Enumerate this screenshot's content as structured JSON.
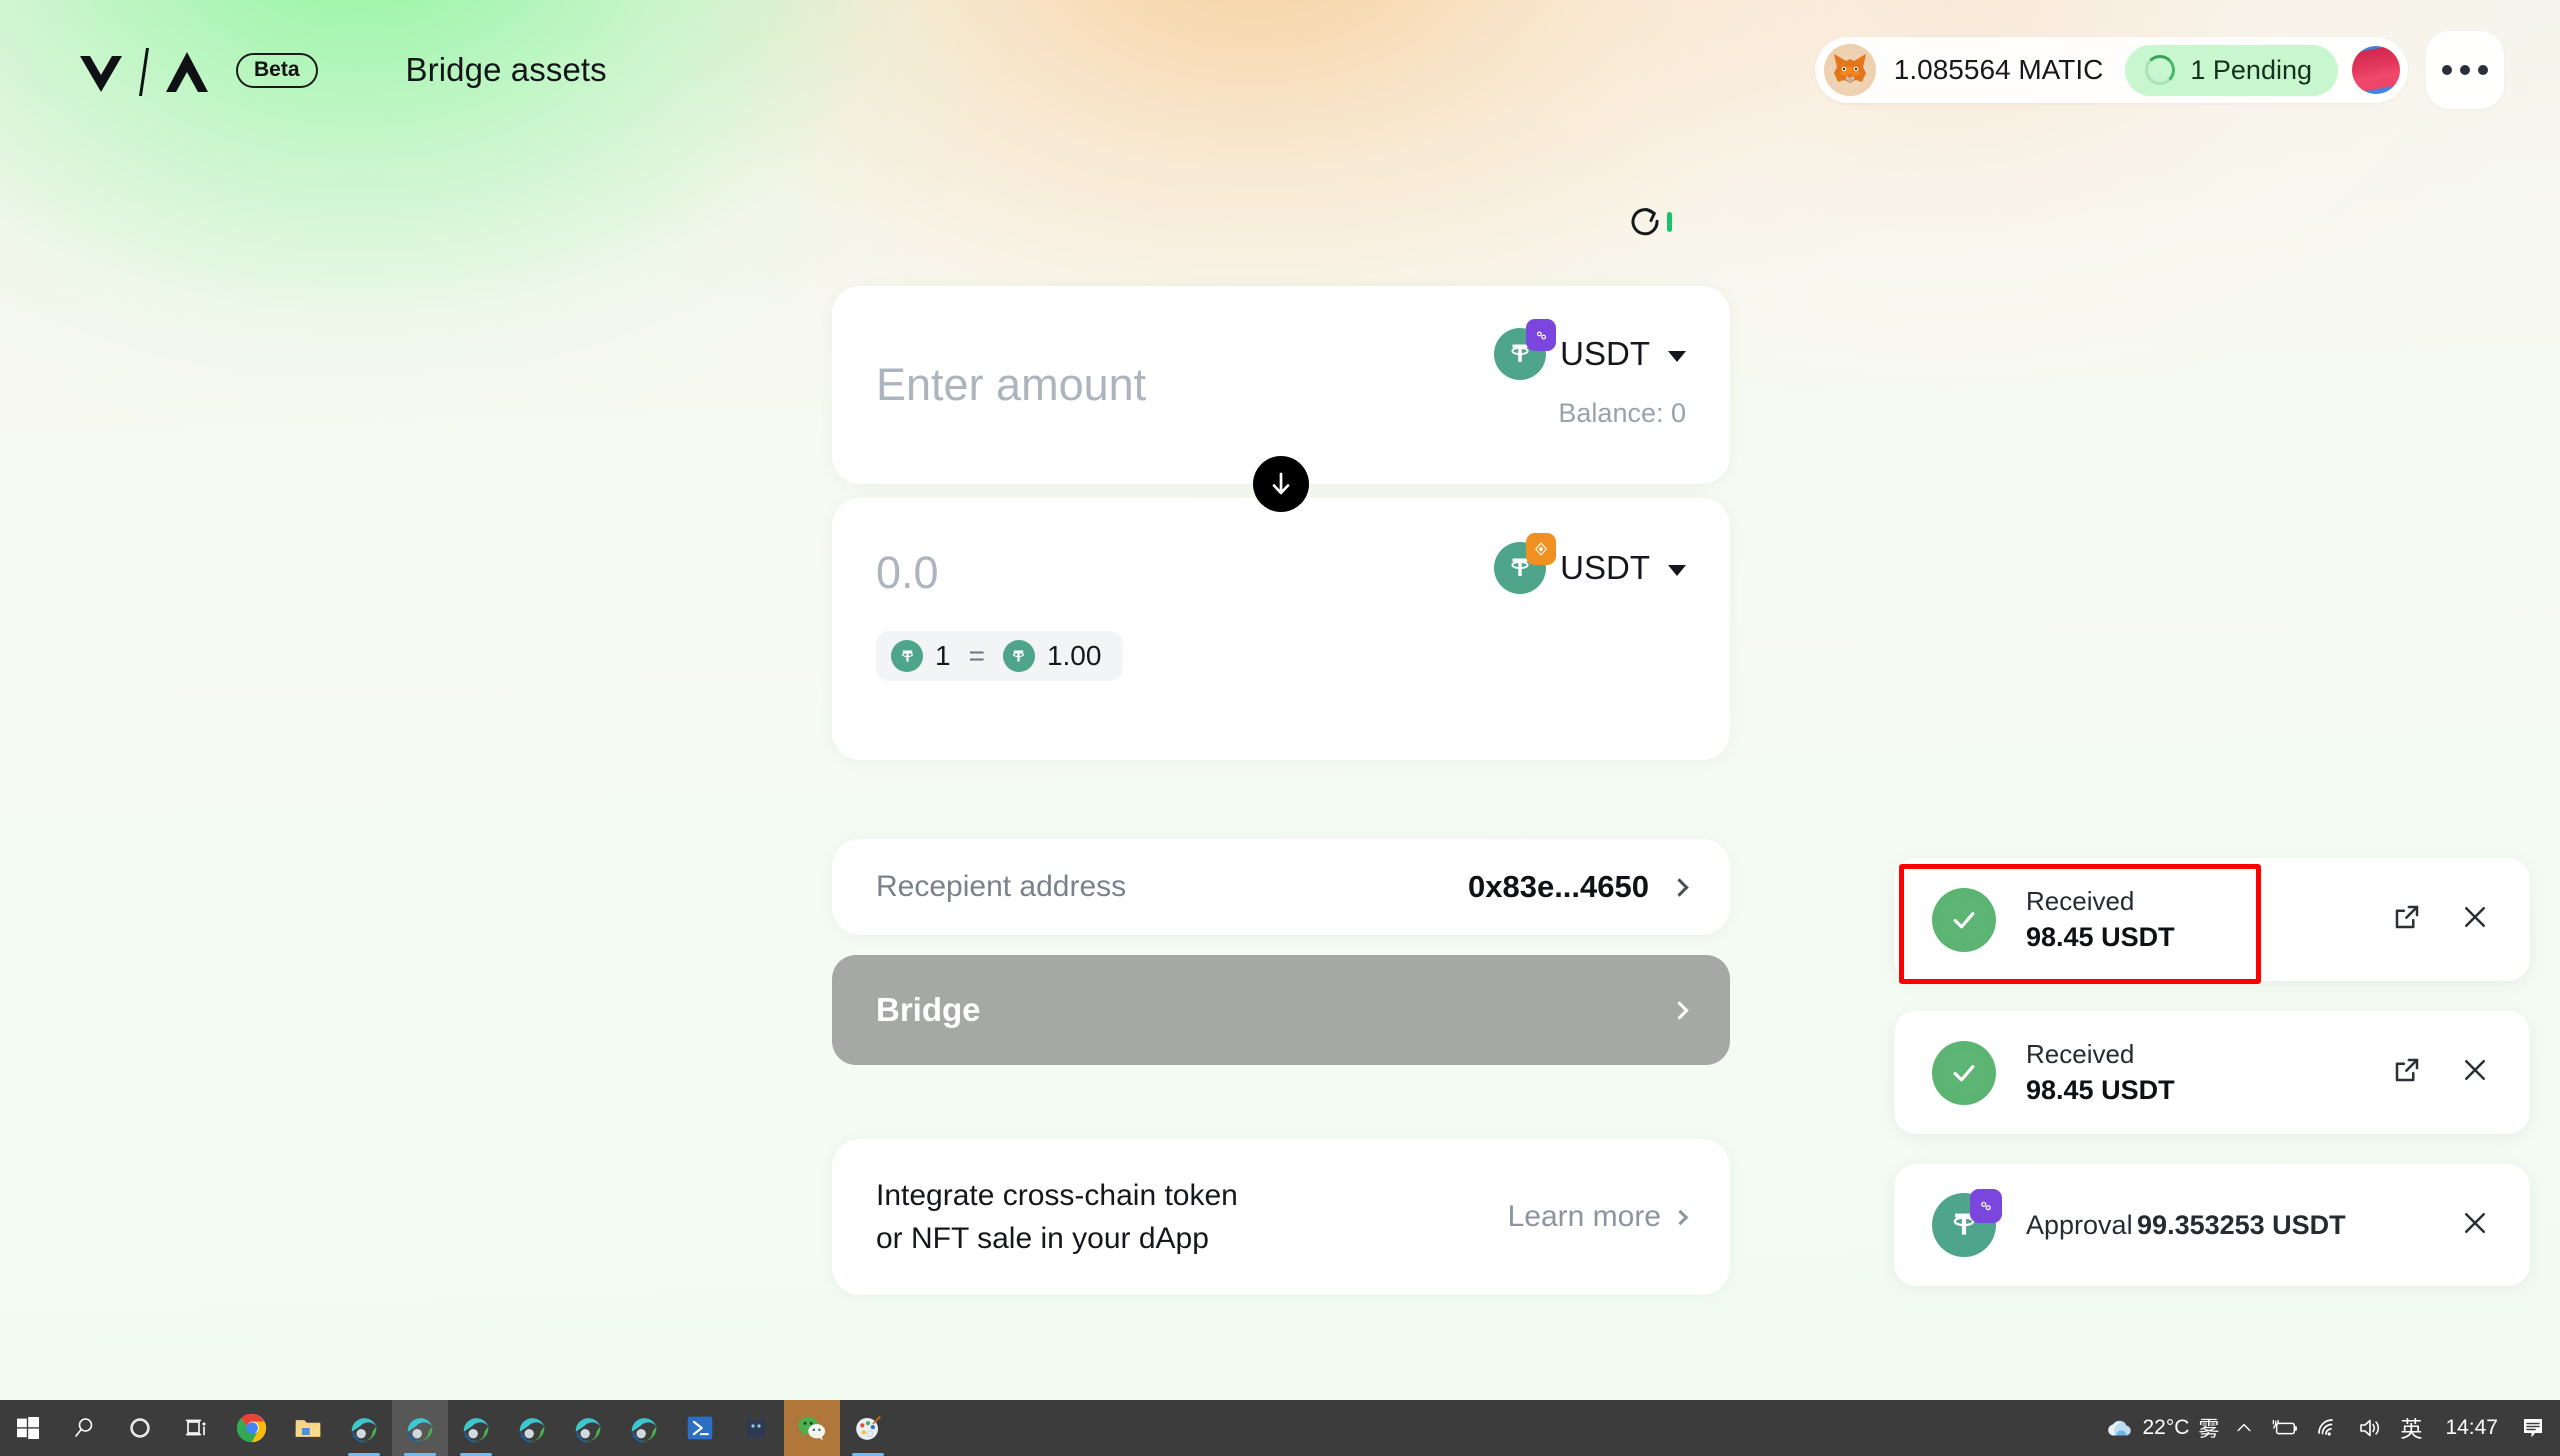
{
  "header": {
    "logo_alt": "VIA",
    "beta_label": "Beta",
    "page_title": "Bridge assets",
    "wallet": {
      "balance": "1.085564 MATIC",
      "pending_label": "1 Pending"
    }
  },
  "bridge": {
    "refresh_icon": "refresh-icon",
    "source": {
      "amount_value": "",
      "amount_placeholder": "Enter amount",
      "token_symbol": "USDT",
      "chain": "polygon",
      "balance_label": "Balance: 0"
    },
    "swap_icon": "arrow-down-icon",
    "destination": {
      "amount_value": "0.0",
      "token_symbol": "USDT",
      "chain": "avalanche",
      "rate": {
        "from_amount": "1",
        "equals": "=",
        "to_amount": "1.00"
      }
    },
    "recipient": {
      "label": "Recepient address",
      "value": "0x83e...4650"
    },
    "bridge_button_label": "Bridge",
    "integrate": {
      "text": "Integrate cross-chain token\nor NFT sale in your dApp",
      "link_label": "Learn more"
    }
  },
  "toasts": [
    {
      "kind": "success",
      "title": "Received",
      "amount": "98.45 USDT",
      "has_external_link": true,
      "highlighted": true
    },
    {
      "kind": "success",
      "title": "Received",
      "amount": "98.45 USDT",
      "has_external_link": true,
      "highlighted": false
    },
    {
      "kind": "token",
      "prefix": "Approval",
      "amount": "99.353253 USDT",
      "chain": "polygon",
      "has_external_link": false,
      "highlighted": false
    }
  ],
  "taskbar": {
    "items": [
      {
        "name": "start-button",
        "icon": "windows-logo-icon"
      },
      {
        "name": "search-button",
        "icon": "search-icon"
      },
      {
        "name": "cortana-button",
        "icon": "cortana-circle-icon"
      },
      {
        "name": "task-view-button",
        "icon": "task-view-icon"
      },
      {
        "name": "chrome-app",
        "icon": "chrome-icon"
      },
      {
        "name": "file-explorer-app",
        "icon": "folder-icon"
      },
      {
        "name": "edge-app-1",
        "icon": "edge-icon"
      },
      {
        "name": "edge-app-2",
        "icon": "edge-icon"
      },
      {
        "name": "edge-app-3",
        "icon": "edge-icon"
      },
      {
        "name": "edge-app-4",
        "icon": "edge-icon"
      },
      {
        "name": "edge-app-5",
        "icon": "edge-icon"
      },
      {
        "name": "edge-app-6",
        "icon": "edge-icon"
      },
      {
        "name": "powershell-app",
        "icon": "powershell-icon"
      },
      {
        "name": "cat-app",
        "icon": "cat-icon"
      },
      {
        "name": "wechat-app",
        "icon": "wechat-icon"
      },
      {
        "name": "paint-app",
        "icon": "paint-icon"
      }
    ],
    "tray": {
      "temperature": "22°C",
      "weather_condition": "雾",
      "ime": "英",
      "clock": "14:47"
    }
  },
  "colors": {
    "accent_green": "#5cb573",
    "pending_bg": "#c8f7cf",
    "tether_green": "#4fa58b",
    "polygon_purple": "#7b46dd",
    "avalanche_orange": "#ef9020",
    "highlight_red": "#ff0000",
    "bridge_disabled": "#a5a8a5",
    "taskbar_bg": "#3c3c3c"
  }
}
